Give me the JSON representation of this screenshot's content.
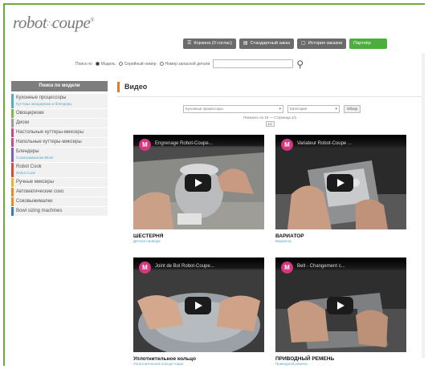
{
  "brand": {
    "logo": "robot",
    "logo_mark": "∴",
    "logo_tail": "coupe",
    "logo_reg": "®"
  },
  "toolbar": {
    "buttons": [
      {
        "icon": "cart-icon",
        "glyph": "☰",
        "label": "Корзина (0 соглас)"
      },
      {
        "icon": "document-icon",
        "glyph": "▤",
        "label": "Стандартный заказ"
      },
      {
        "icon": "history-icon",
        "glyph": "▢",
        "label": "История заказов"
      },
      {
        "icon": "partner-icon",
        "glyph": "",
        "label": "Партнёр"
      }
    ]
  },
  "search": {
    "prefix": "Поиск по",
    "options": [
      {
        "label": "Модель",
        "selected": true
      },
      {
        "label": "Серийный номер",
        "selected": false
      },
      {
        "label": "Номер запасной детали",
        "selected": false
      }
    ],
    "value": ""
  },
  "sidebar": {
    "heading": "Поиск по модели",
    "items": [
      {
        "label": "Кухонные процессоры",
        "sub": "Куттеры-овощерезки и блендеры",
        "color": "#5aa9c6"
      },
      {
        "label": "Овощерезки",
        "sub": "",
        "color": "#7db648"
      },
      {
        "label": "Диски",
        "sub": "",
        "color": "#9a9a9a"
      },
      {
        "label": "Настольные куттеры-миксеры",
        "sub": "",
        "color": "#c74a8e"
      },
      {
        "label": "Напольные куттеры-миксеры",
        "sub": "",
        "color": "#c74a8e"
      },
      {
        "label": "Блендеры",
        "sub": "Соковыжималки Blixer",
        "color": "#7f5fb0"
      },
      {
        "label": "Robot Cook",
        "sub": "Robot Cook",
        "color": "#d94c3d"
      },
      {
        "label": "Ручные миксеры",
        "sub": "",
        "color": "#e2b62e"
      },
      {
        "label": "Автоматические соко",
        "sub": "",
        "color": "#e78a2b"
      },
      {
        "label": "Соковыжималки",
        "sub": "",
        "color": "#e78a2b"
      },
      {
        "label": "Bowl sizing machines",
        "sub": "",
        "color": "#3a7bb8"
      }
    ]
  },
  "main": {
    "title": "Видео",
    "filters": {
      "select1": "Кухонные процессоры",
      "select2": "Категория",
      "button": "Обзор"
    },
    "count_text": "Показать по 10 — Страница 1/1",
    "pager": "1/1",
    "videos": [
      {
        "channel": "M",
        "title": "Engrenage Robot-Coupe...",
        "caption": "ШЕСТЕРНЯ",
        "sub": "Детали привода"
      },
      {
        "channel": "M",
        "title": "Variateur Robot-Coupe ...",
        "caption": "ВАРИАТОР",
        "sub": "Вариатор"
      },
      {
        "channel": "M",
        "title": "Joint de Bol Robot-Coupe...",
        "caption": "Уплотнительное кольцо",
        "sub": "Уплотнительное кольцо чаши"
      },
      {
        "channel": "M",
        "title": "Belt - Changement c...",
        "caption": "ПРИВОДНЫЙ РЕМЕНЬ",
        "sub": "Приводной ремень"
      }
    ]
  }
}
